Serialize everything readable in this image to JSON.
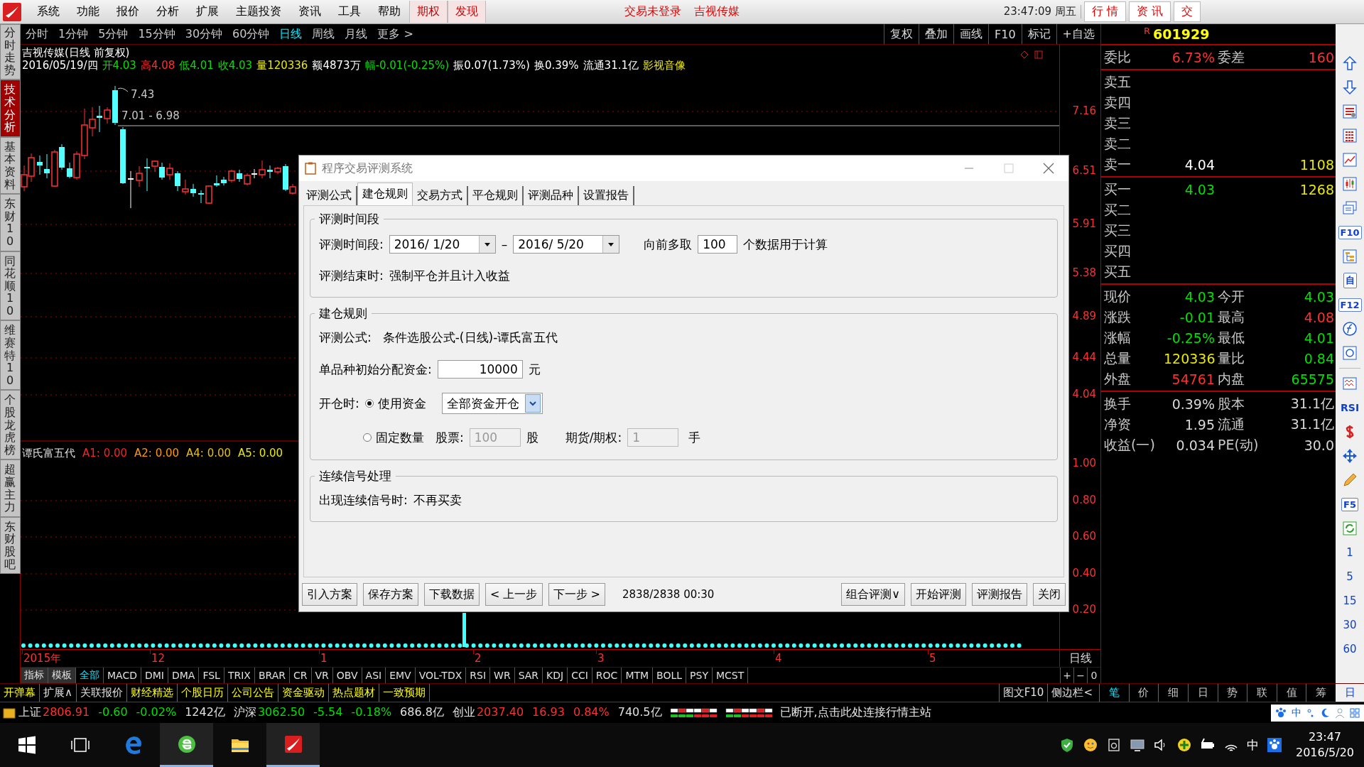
{
  "menubar": {
    "items": [
      {
        "label": "系统",
        "kind": "menu"
      },
      {
        "label": "功能",
        "kind": "menu"
      },
      {
        "label": "报价",
        "kind": "menu"
      },
      {
        "label": "分析",
        "kind": "menu"
      },
      {
        "label": "扩展",
        "kind": "menu"
      },
      {
        "label": "主题投资",
        "kind": "menu"
      },
      {
        "label": "资讯",
        "kind": "menu"
      },
      {
        "label": "工具",
        "kind": "menu"
      },
      {
        "label": "帮助",
        "kind": "menu"
      },
      {
        "label": "期权",
        "kind": "highlight"
      },
      {
        "label": "发现",
        "kind": "highlight"
      }
    ],
    "notice": "交易未登录",
    "stock_name": "吉视传媒",
    "clock": "23:47:09 周五",
    "tabs": [
      "行 情",
      "资 讯",
      "交"
    ]
  },
  "period_bar": {
    "periods": [
      {
        "label": "分时",
        "selected": false
      },
      {
        "label": "1分钟",
        "selected": false
      },
      {
        "label": "5分钟",
        "selected": false
      },
      {
        "label": "15分钟",
        "selected": false
      },
      {
        "label": "30分钟",
        "selected": false
      },
      {
        "label": "60分钟",
        "selected": false
      },
      {
        "label": "日线",
        "selected": true
      },
      {
        "label": "周线",
        "selected": false
      },
      {
        "label": "月线",
        "selected": false
      },
      {
        "label": "更多 >",
        "selected": false
      }
    ],
    "actions": [
      "复权",
      "叠加",
      "画线",
      "F10",
      "标记",
      "+自选"
    ]
  },
  "side_tabs": [
    {
      "label": "分时走势",
      "selected": false
    },
    {
      "label": "技术分析",
      "selected": true
    },
    {
      "label": "基本资料",
      "selected": false
    },
    {
      "label": "东财10",
      "selected": false
    },
    {
      "label": "同花顺10",
      "selected": false
    },
    {
      "label": "维赛特10",
      "selected": false
    },
    {
      "label": "个股龙虎榜",
      "selected": false
    },
    {
      "label": "超赢主力",
      "selected": false
    },
    {
      "label": "东财股吧",
      "selected": false
    }
  ],
  "chart": {
    "title": "吉视传媒(日线 前复权)",
    "quote": [
      {
        "text": "2016/05/19/四",
        "color": "#ffffff"
      },
      {
        "text": "开4.03",
        "color": "#00e000"
      },
      {
        "text": "高4.08",
        "color": "#ff3030"
      },
      {
        "text": "低4.01",
        "color": "#00e000"
      },
      {
        "text": "收4.03",
        "color": "#00e000"
      },
      {
        "text": "量120336",
        "color": "#e8e800"
      },
      {
        "text": "额4873万",
        "color": "#ffffff"
      },
      {
        "text": "幅-0.01(-0.25%)",
        "color": "#00e000"
      },
      {
        "text": "振0.07(1.73%)",
        "color": "#ffffff"
      },
      {
        "text": "换0.39%",
        "color": "#ffffff"
      },
      {
        "text": "流通31.1亿",
        "color": "#ffffff"
      },
      {
        "text": "影视音像",
        "color": "#e8e800"
      }
    ],
    "high_mark": "7.43",
    "range_mark": "7.01 - 6.98",
    "price_axis": [
      "7.16",
      "6.51",
      "5.91",
      "5.38",
      "4.89",
      "4.44",
      "4.04"
    ],
    "indicator": {
      "name": "谭氏富五代",
      "values": [
        {
          "text": "A1: 0.00",
          "color": "#ff2020"
        },
        {
          "text": "A2: 0.00",
          "color": "#ff9900"
        },
        {
          "text": "A4: 0.00",
          "color": "#e8c000"
        },
        {
          "text": "A5: 0.00",
          "color": "#e8e800"
        }
      ]
    },
    "indicator_axis": [
      "1.00",
      "0.80",
      "0.60",
      "0.40",
      "0.20"
    ],
    "dates": [
      "2015年",
      "12",
      "1",
      "2",
      "3",
      "4",
      "5"
    ],
    "period_label": "日线"
  },
  "indicator_tabs": [
    {
      "label": "指标",
      "selected": false
    },
    {
      "label": "模板",
      "selected": false
    },
    {
      "label": "全部",
      "selected": true
    },
    {
      "label": "MACD",
      "selected": false
    },
    {
      "label": "DMI",
      "selected": false
    },
    {
      "label": "DMA",
      "selected": false
    },
    {
      "label": "FSL",
      "selected": false
    },
    {
      "label": "TRIX",
      "selected": false
    },
    {
      "label": "BRAR",
      "selected": false
    },
    {
      "label": "CR",
      "selected": false
    },
    {
      "label": "VR",
      "selected": false
    },
    {
      "label": "OBV",
      "selected": false
    },
    {
      "label": "ASI",
      "selected": false
    },
    {
      "label": "EMV",
      "selected": false
    },
    {
      "label": "VOL-TDX",
      "selected": false
    },
    {
      "label": "RSI",
      "selected": false
    },
    {
      "label": "WR",
      "selected": false
    },
    {
      "label": "SAR",
      "selected": false
    },
    {
      "label": "KDJ",
      "selected": false
    },
    {
      "label": "CCI",
      "selected": false
    },
    {
      "label": "ROC",
      "selected": false
    },
    {
      "label": "MTM",
      "selected": false
    },
    {
      "label": "BOLL",
      "selected": false
    },
    {
      "label": "PSY",
      "selected": false
    },
    {
      "label": "MCST",
      "selected": false
    }
  ],
  "zoom_buttons": [
    "+",
    "−",
    "0"
  ],
  "function_bar": {
    "items": [
      {
        "label": "开弹幕",
        "color": "#ffff00"
      },
      {
        "label": "扩展∧",
        "color": "#e0e0e0"
      },
      {
        "label": "关联报价",
        "color": "#e0e0e0"
      },
      {
        "label": "财经精选",
        "color": "#ffff00"
      },
      {
        "label": "个股日历",
        "color": "#ffff00"
      },
      {
        "label": "公司公告",
        "color": "#ffff00"
      },
      {
        "label": "资金驱动",
        "color": "#ffff00"
      },
      {
        "label": "热点题材",
        "color": "#ffff00"
      },
      {
        "label": "一致预期",
        "color": "#ffff00"
      }
    ],
    "right": [
      "图文F10",
      "侧边栏<"
    ],
    "panel_tabs": [
      {
        "label": "笔",
        "selected": true
      },
      {
        "label": "价",
        "selected": false
      },
      {
        "label": "细",
        "selected": false
      },
      {
        "label": "日",
        "selected": false
      },
      {
        "label": "势",
        "selected": false
      },
      {
        "label": "联",
        "selected": false
      },
      {
        "label": "值",
        "selected": false
      },
      {
        "label": "筹",
        "selected": false
      }
    ]
  },
  "quote_panel": {
    "flag": "R",
    "code": "601929",
    "sections": [
      [
        {
          "label": "委比",
          "value": {
            "text": "6.73%",
            "color": "#ff3030"
          },
          "label2": "委差",
          "value2": {
            "text": "160",
            "color": "#ff3030"
          }
        }
      ],
      [
        {
          "label": "卖五"
        },
        {
          "label": "卖四"
        },
        {
          "label": "卖三"
        },
        {
          "label": "卖二"
        },
        {
          "label": "卖一",
          "value": {
            "text": "4.04",
            "color": "#ffffff"
          },
          "value2": {
            "text": "1108",
            "color": "#e8e800"
          }
        }
      ],
      [
        {
          "label": "买一",
          "value": {
            "text": "4.03",
            "color": "#00e000"
          },
          "value2": {
            "text": "1268",
            "color": "#e8e800"
          }
        },
        {
          "label": "买二"
        },
        {
          "label": "买三"
        },
        {
          "label": "买四"
        },
        {
          "label": "买五"
        }
      ],
      [
        {
          "label": "现价",
          "value": {
            "text": "4.03",
            "color": "#00e000"
          },
          "label2": "今开",
          "value2": {
            "text": "4.03",
            "color": "#00e000"
          }
        },
        {
          "label": "涨跌",
          "value": {
            "text": "-0.01",
            "color": "#00e000"
          },
          "label2": "最高",
          "value2": {
            "text": "4.08",
            "color": "#ff3030"
          }
        },
        {
          "label": "涨幅",
          "value": {
            "text": "-0.25%",
            "color": "#00e000"
          },
          "label2": "最低",
          "value2": {
            "text": "4.01",
            "color": "#00e000"
          }
        },
        {
          "label": "总量",
          "value": {
            "text": "120336",
            "color": "#e8e800"
          },
          "label2": "量比",
          "value2": {
            "text": "0.84",
            "color": "#00e000"
          }
        },
        {
          "label": "外盘",
          "value": {
            "text": "54761",
            "color": "#ff3030"
          },
          "label2": "内盘",
          "value2": {
            "text": "65575",
            "color": "#00e000"
          }
        }
      ],
      [
        {
          "label": "换手",
          "value": {
            "text": "0.39%",
            "color": "#d8d8d8"
          },
          "label2": "股本",
          "value2": {
            "text": "31.1亿",
            "color": "#d8d8d8"
          }
        },
        {
          "label": "净资",
          "value": {
            "text": "1.95",
            "color": "#d8d8d8"
          },
          "label2": "流通",
          "value2": {
            "text": "31.1亿",
            "color": "#d8d8d8"
          }
        },
        {
          "label": "收益(一)",
          "value": {
            "text": "0.034",
            "color": "#d8d8d8"
          },
          "label2": "PE(动)",
          "value2": {
            "text": "30.0",
            "color": "#d8d8d8"
          }
        }
      ]
    ]
  },
  "tool_texts": [
    "F10",
    "自",
    "F12",
    "RSI",
    "F5"
  ],
  "tool_periods": [
    "1",
    "5",
    "15",
    "30",
    "60"
  ],
  "tool_bottom": "日",
  "status_bar": {
    "indices": [
      {
        "name": "上证",
        "value": {
          "text": "2806.91",
          "color": "#ff3030"
        },
        "change": {
          "text": "-0.60",
          "color": "#00e000"
        },
        "percent": {
          "text": "-0.02%",
          "color": "#00e000"
        },
        "amount": "1242亿"
      },
      {
        "name": "沪深",
        "value": {
          "text": "3062.50",
          "color": "#00e000"
        },
        "change": {
          "text": "-5.54",
          "color": "#00e000"
        },
        "percent": {
          "text": "-0.18%",
          "color": "#00e000"
        },
        "amount": "686.8亿"
      },
      {
        "name": "创业",
        "value": {
          "text": "2037.40",
          "color": "#ff3030"
        },
        "change": {
          "text": "16.93",
          "color": "#ff3030"
        },
        "percent": {
          "text": "0.84%",
          "color": "#ff3030"
        },
        "amount": "740.5亿"
      }
    ],
    "message": "已断开,点击此处连接行情主站",
    "ime": "中"
  },
  "dialog": {
    "title": "程序交易评测系统",
    "tabs": [
      {
        "label": "评测公式",
        "selected": false
      },
      {
        "label": "建仓规则",
        "selected": true
      },
      {
        "label": "交易方式",
        "selected": false
      },
      {
        "label": "平仓规则",
        "selected": false
      },
      {
        "label": "评测品种",
        "selected": false
      },
      {
        "label": "设置报告",
        "selected": false
      }
    ],
    "period_group": {
      "legend": "评测时间段",
      "range_label": "评测时间段:",
      "start": "2016/ 1/20",
      "dash": "–",
      "end": "2016/ 5/20",
      "lookback_label": "向前多取",
      "lookback": "100",
      "lookback_unit": "个数据用于计算",
      "end_rule_label": "评测结束时:",
      "end_rule": "强制平仓并且计入收益"
    },
    "entry_group": {
      "legend": "建仓规则",
      "formula_label": "评测公式:",
      "formula": "条件选股公式-(日线)-谭氏富五代",
      "capital_label": "单品种初始分配资金:",
      "capital": "10000",
      "capital_unit": "元",
      "open_label": "开仓时:",
      "modes": [
        {
          "label": "使用资金",
          "selected": true
        },
        {
          "label": "固定数量",
          "selected": false
        }
      ],
      "fund_mode": "全部资金开仓",
      "stock_label": "股票:",
      "stock_qty": {
        "value": "100",
        "disabled": true
      },
      "stock_unit": "股",
      "futures_label": "期货/期权:",
      "futures_qty": {
        "value": "1",
        "disabled": true
      },
      "futures_unit": "手"
    },
    "signal_group": {
      "legend": "连续信号处理",
      "rule_label": "出现连续信号时:",
      "rule": "不再买卖"
    },
    "buttons_left": [
      "引入方案",
      "保存方案",
      "下载数据",
      "< 上一步",
      "下一步 >"
    ],
    "progress": "2838/2838 00:30",
    "buttons_right": [
      "组合评测∨",
      "开始评测",
      "评测报告",
      "关闭"
    ]
  },
  "taskbar": {
    "ime": "中",
    "time": "23:47",
    "date": "2016/5/20"
  }
}
